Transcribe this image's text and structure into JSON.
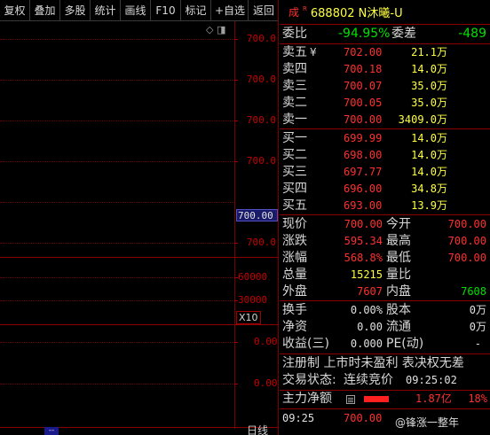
{
  "toolbar": {
    "buttons": [
      "复权",
      "叠加",
      "多股",
      "统计",
      "画线",
      "F10",
      "标记",
      "+自选",
      "返回"
    ]
  },
  "chart": {
    "price_ticks": [
      "700.0",
      "700.0",
      "700.0",
      "700.0",
      "700.0",
      "700.0"
    ],
    "current_price_tag": "700.00",
    "volume_ticks": [
      "60000",
      "30000"
    ],
    "volume_unit": "X10",
    "indicator_ticks": [
      "0.00",
      "0.00"
    ],
    "period_label": "日线",
    "bottom_mark": "--"
  },
  "quote": {
    "trade_flag": "成",
    "badge": "R",
    "stock_title": "688802 N沐曦-U",
    "weibi_label": "委比",
    "weibi_value": "-94.95%",
    "weicha_label": "委差",
    "weicha_value": "-489",
    "sell": [
      {
        "label": "卖五",
        "mark": "¥",
        "price": "702.00",
        "volume": "21.1万"
      },
      {
        "label": "卖四",
        "mark": "",
        "price": "700.18",
        "volume": "14.0万"
      },
      {
        "label": "卖三",
        "mark": "",
        "price": "700.07",
        "volume": "35.0万"
      },
      {
        "label": "卖二",
        "mark": "",
        "price": "700.05",
        "volume": "35.0万"
      },
      {
        "label": "卖一",
        "mark": "",
        "price": "700.00",
        "volume": "3409.0万"
      }
    ],
    "buy": [
      {
        "label": "买一",
        "price": "699.99",
        "volume": "14.0万"
      },
      {
        "label": "买二",
        "price": "698.00",
        "volume": "14.0万"
      },
      {
        "label": "买三",
        "price": "697.77",
        "volume": "14.0万"
      },
      {
        "label": "买四",
        "price": "696.00",
        "volume": "34.8万"
      },
      {
        "label": "买五",
        "price": "693.00",
        "volume": "13.9万"
      }
    ],
    "stats": [
      {
        "l1": "现价",
        "v1": "700.00",
        "l2": "今开",
        "v2": "700.00"
      },
      {
        "l1": "涨跌",
        "v1": "595.34",
        "l2": "最高",
        "v2": "700.00"
      },
      {
        "l1": "涨幅",
        "v1": "568.8%",
        "l2": "最低",
        "v2": "700.00"
      },
      {
        "l1": "总量",
        "v1": "15215",
        "l2": "量比",
        "v2": ""
      },
      {
        "l1": "外盘",
        "v1": "7607",
        "l2": "内盘",
        "v2": "7608"
      }
    ],
    "fin": [
      {
        "l1": "换手",
        "v1": "0.00%",
        "l2": "股本",
        "v2": "0万"
      },
      {
        "l1": "净资",
        "v1": "0.00",
        "l2": "流通",
        "v2": "0万"
      },
      {
        "l1": "收益(三)",
        "v1": "0.000",
        "l2": "PE(动)",
        "v2": "-"
      }
    ],
    "notice": "注册制 上市时未盈利 表决权无差",
    "status_label": "交易状态:",
    "status_value": "连续竞价",
    "status_time": "09:25:02",
    "main_flow_label": "主力净额",
    "main_flow_value": "1.87亿",
    "main_flow_pct": "18%",
    "tick_time": "09:25",
    "tick_price": "700.00",
    "watermark": "@锋涨一整年"
  },
  "colors": {
    "up": "#ff3030",
    "down": "#00e000",
    "title": "#ffff40",
    "grid": "#8a0000"
  }
}
